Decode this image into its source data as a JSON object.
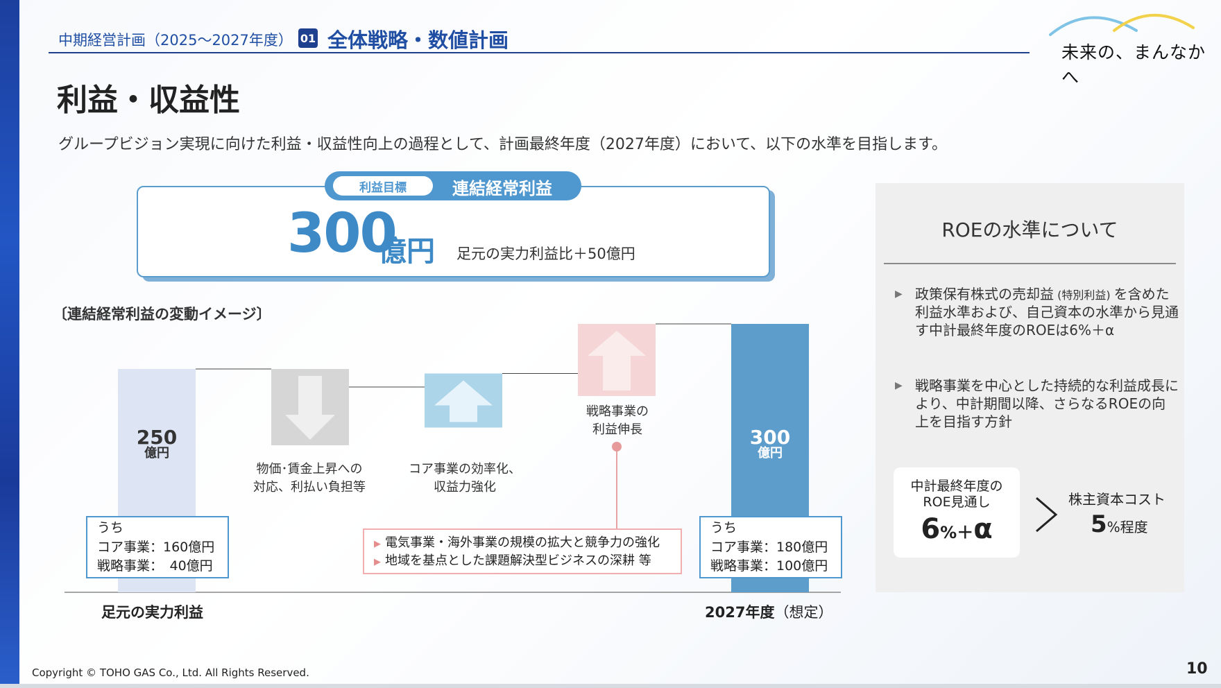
{
  "header": {
    "plan_label": "中期経営計画（2025〜2027年度）",
    "section_number": "01",
    "section_title": "全体戦略・数値計画"
  },
  "logo": {
    "text": "未来の、まんなかへ"
  },
  "page": {
    "title": "利益・収益性",
    "lead": "グループビジョン実現に向けた利益・収益性向上の過程として、計画最終年度（2027年度）において、以下の水準を目指します。"
  },
  "target": {
    "badge": "利益目標",
    "label": "連結経常利益",
    "value": "300",
    "unit": "億円",
    "note": "足元の実力利益比＋50億円"
  },
  "chart_caption": "〔連結経常利益の変動イメージ〕",
  "chart_data": {
    "type": "bar",
    "categories": [
      "足元の実力利益",
      "物価･賃金上昇への対応、利払い負担等",
      "コア事業の効率化、収益力強化",
      "戦略事業の利益伸長",
      "2027年度（想定）"
    ],
    "values": [
      250,
      -20,
      15,
      55,
      300
    ],
    "start": {
      "value": "250",
      "unit": "億円",
      "label": "足元の実力利益",
      "breakdown": [
        "うち",
        "コア事業：160億円",
        "戦略事業：　40億円"
      ]
    },
    "end": {
      "value": "300",
      "unit": "億円",
      "label_bold": "2027年度",
      "label_rest": "（想定）",
      "breakdown": [
        "うち",
        "コア事業：180億円",
        "戦略事業：100億円"
      ]
    },
    "steps": [
      {
        "direction": "down",
        "label_lines": [
          "物価･賃金上昇への",
          "対応、利払い負担等"
        ],
        "color": "#d6d6d6"
      },
      {
        "direction": "up",
        "label_lines": [
          "コア事業の効率化、",
          "収益力強化"
        ],
        "color": "#acd5e9"
      },
      {
        "direction": "up",
        "label_lines": [
          "戦略事業の",
          "利益伸長"
        ],
        "color": "#f5d5d5"
      }
    ],
    "strategic_points": [
      "電気事業・海外事業の規模の拡大と競争力の強化",
      "地域を基点とした課題解決型ビジネスの深耕 等"
    ],
    "colors": {
      "start_bar": "#dde4f4",
      "end_bar": "#5c9dcc"
    }
  },
  "roe": {
    "title": "ROEの水準について",
    "bullets": [
      {
        "pre": "政策保有株式の売却益",
        "small": " (特別利益) ",
        "post": "を含めた利益水準および、自己資本の水準から見通す中計最終年度のROEは6%＋α"
      },
      {
        "pre": "戦略事業を中心とした持続的な利益成長により、中計期間以降、さらなるROEの向上を目指す方針",
        "small": "",
        "post": ""
      }
    ],
    "card": {
      "caption_line1": "中計最終年度の",
      "caption_line2": "ROE見通し",
      "num": "6",
      "pct": "%",
      "plus": "＋",
      "alpha": "α"
    },
    "cost": {
      "caption": "株主資本コスト",
      "num": "5",
      "suffix": "%程度"
    }
  },
  "footer": {
    "copyright": "Copyright © TOHO GAS Co., Ltd. All Rights Reserved.",
    "page_number": "10"
  }
}
